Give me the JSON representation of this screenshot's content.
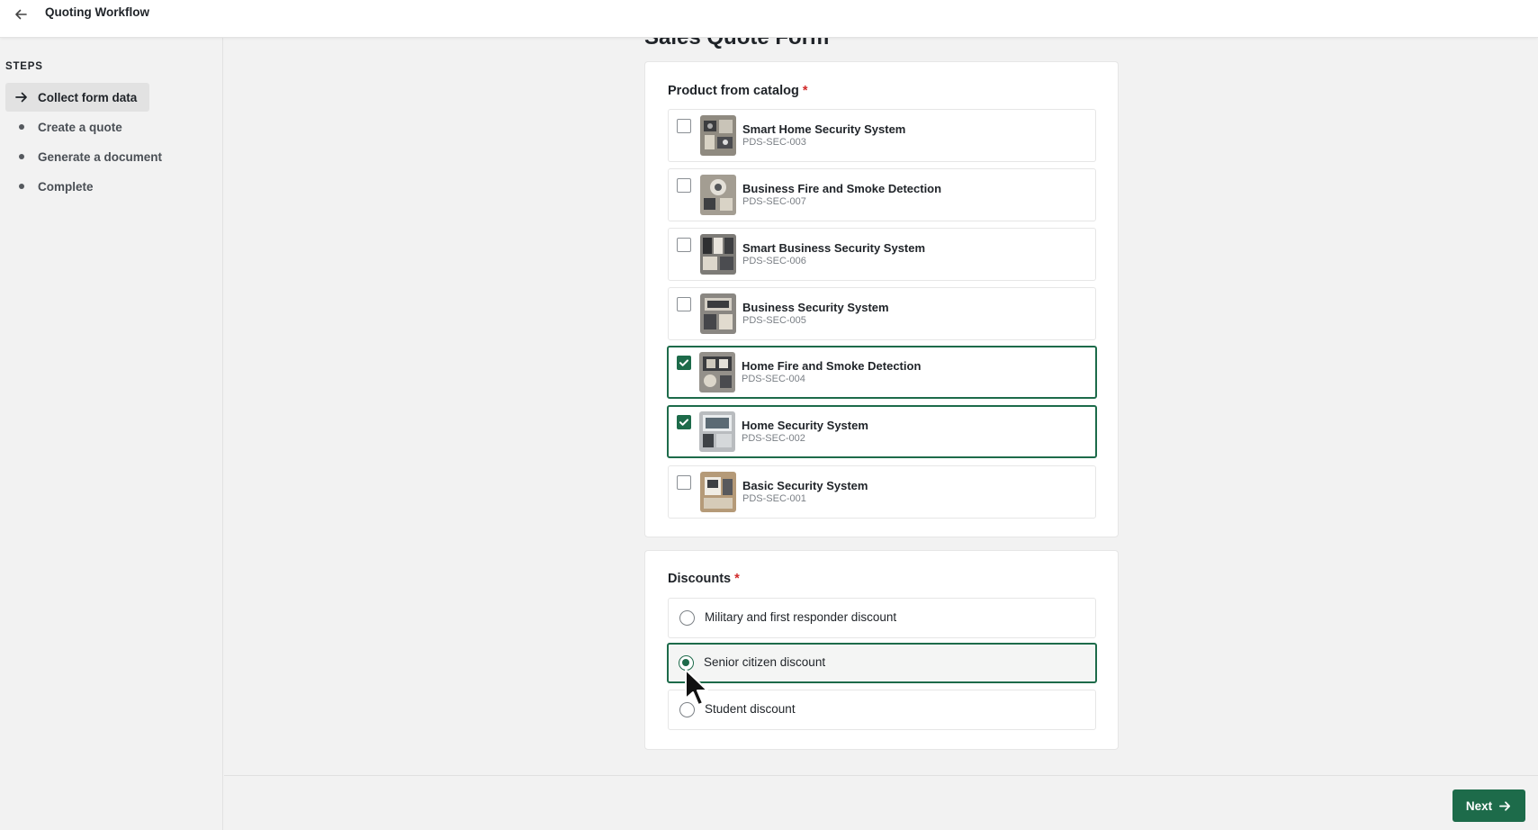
{
  "header": {
    "title": "Quoting Workflow"
  },
  "sidebar": {
    "heading": "STEPS",
    "steps": [
      {
        "label": "Collect form data",
        "active": true
      },
      {
        "label": "Create a quote",
        "active": false
      },
      {
        "label": "Generate a document",
        "active": false
      },
      {
        "label": "Complete",
        "active": false
      }
    ]
  },
  "form": {
    "title": "Sales Quote Form",
    "products": {
      "heading": "Product from catalog",
      "required_mark": "*",
      "items": [
        {
          "name": "Smart Home Security System",
          "code": "PDS-SEC-003",
          "checked": false
        },
        {
          "name": "Business Fire and Smoke Detection",
          "code": "PDS-SEC-007",
          "checked": false
        },
        {
          "name": "Smart Business Security System",
          "code": "PDS-SEC-006",
          "checked": false
        },
        {
          "name": "Business Security System",
          "code": "PDS-SEC-005",
          "checked": false
        },
        {
          "name": "Home Fire and Smoke Detection",
          "code": "PDS-SEC-004",
          "checked": true
        },
        {
          "name": "Home Security System",
          "code": "PDS-SEC-002",
          "checked": true
        },
        {
          "name": "Basic Security System",
          "code": "PDS-SEC-001",
          "checked": false
        }
      ]
    },
    "discounts": {
      "heading": "Discounts",
      "required_mark": "*",
      "options": [
        {
          "label": "Military and first responder discount",
          "selected": false
        },
        {
          "label": "Senior citizen discount",
          "selected": true
        },
        {
          "label": "Student discount",
          "selected": false
        }
      ]
    }
  },
  "footer": {
    "next_label": "Next"
  },
  "colors": {
    "accent": "#1d6b4a",
    "required": "#d12a2a"
  },
  "icons": {
    "back": "arrow-left-icon",
    "next": "arrow-right-icon",
    "active_step": "arrow-right-icon"
  }
}
